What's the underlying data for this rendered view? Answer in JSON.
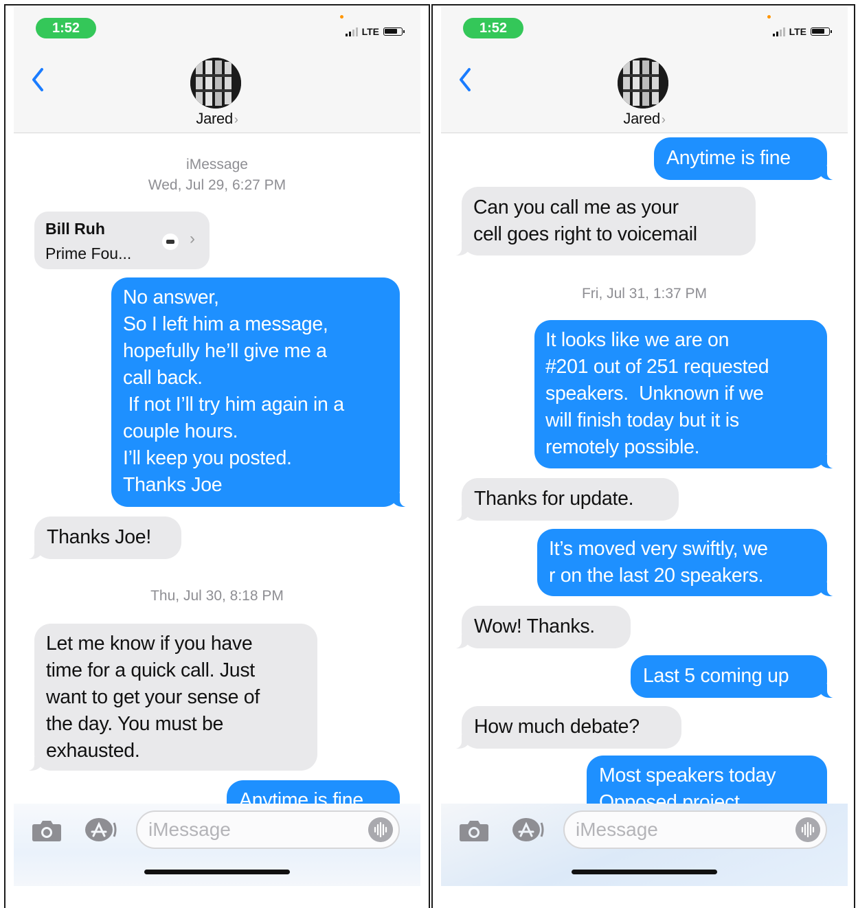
{
  "left": {
    "status": {
      "time": "1:52",
      "network": "LTE"
    },
    "contact": {
      "name": "Jared",
      "chevron": "›"
    },
    "service": "iMessage",
    "date1": "Wed, Jul 29, 6:27 PM",
    "contact_card": {
      "name": "Bill Ruh",
      "company": "Prime Fou...",
      "chevron": "›"
    },
    "msg_no_answer": [
      "No answer,",
      "So I left him a message,",
      "hopefully he’ll give me a",
      "call back.",
      " If not I’ll try him again in a",
      "couple hours.",
      "I’ll keep you posted.",
      "Thanks Joe"
    ],
    "msg_thanks_joe": "Thanks Joe!",
    "date2": "Thu, Jul 30, 8:18 PM",
    "msg_let_me_know": [
      "Let me know if you have",
      "time for a quick call. Just",
      "want to get your sense of",
      "the day. You must be",
      "exhausted."
    ],
    "msg_anytime_partial": "Anytime is fine",
    "composer_placeholder": "iMessage"
  },
  "right": {
    "status": {
      "time": "1:52",
      "network": "LTE"
    },
    "contact": {
      "name": "Jared",
      "chevron": "›"
    },
    "msg_anytime": "Anytime is fine",
    "msg_call_me": [
      "Can you call me as your",
      "cell goes right to voicemail"
    ],
    "date3": "Fri, Jul 31, 1:37 PM",
    "msg_looks_like": [
      "It looks like we are on",
      "#201 out of 251 requested",
      "speakers.  Unknown if we",
      "will finish today but it is",
      "remotely possible."
    ],
    "msg_thanks_update": "Thanks for update.",
    "msg_moved": [
      "It’s moved very swiftly, we",
      "r on the last 20 speakers."
    ],
    "msg_wow": "Wow! Thanks.",
    "msg_last5": "Last 5 coming up",
    "msg_debate": "How much debate?",
    "msg_most_speakers": [
      "Most speakers today",
      "Opposed project"
    ],
    "composer_placeholder": "iMessage"
  },
  "colors": {
    "outgoing": "#1e90ff",
    "incoming": "#e9e9eb",
    "time_pill": "#34c759",
    "accent": "#1a7cff"
  }
}
